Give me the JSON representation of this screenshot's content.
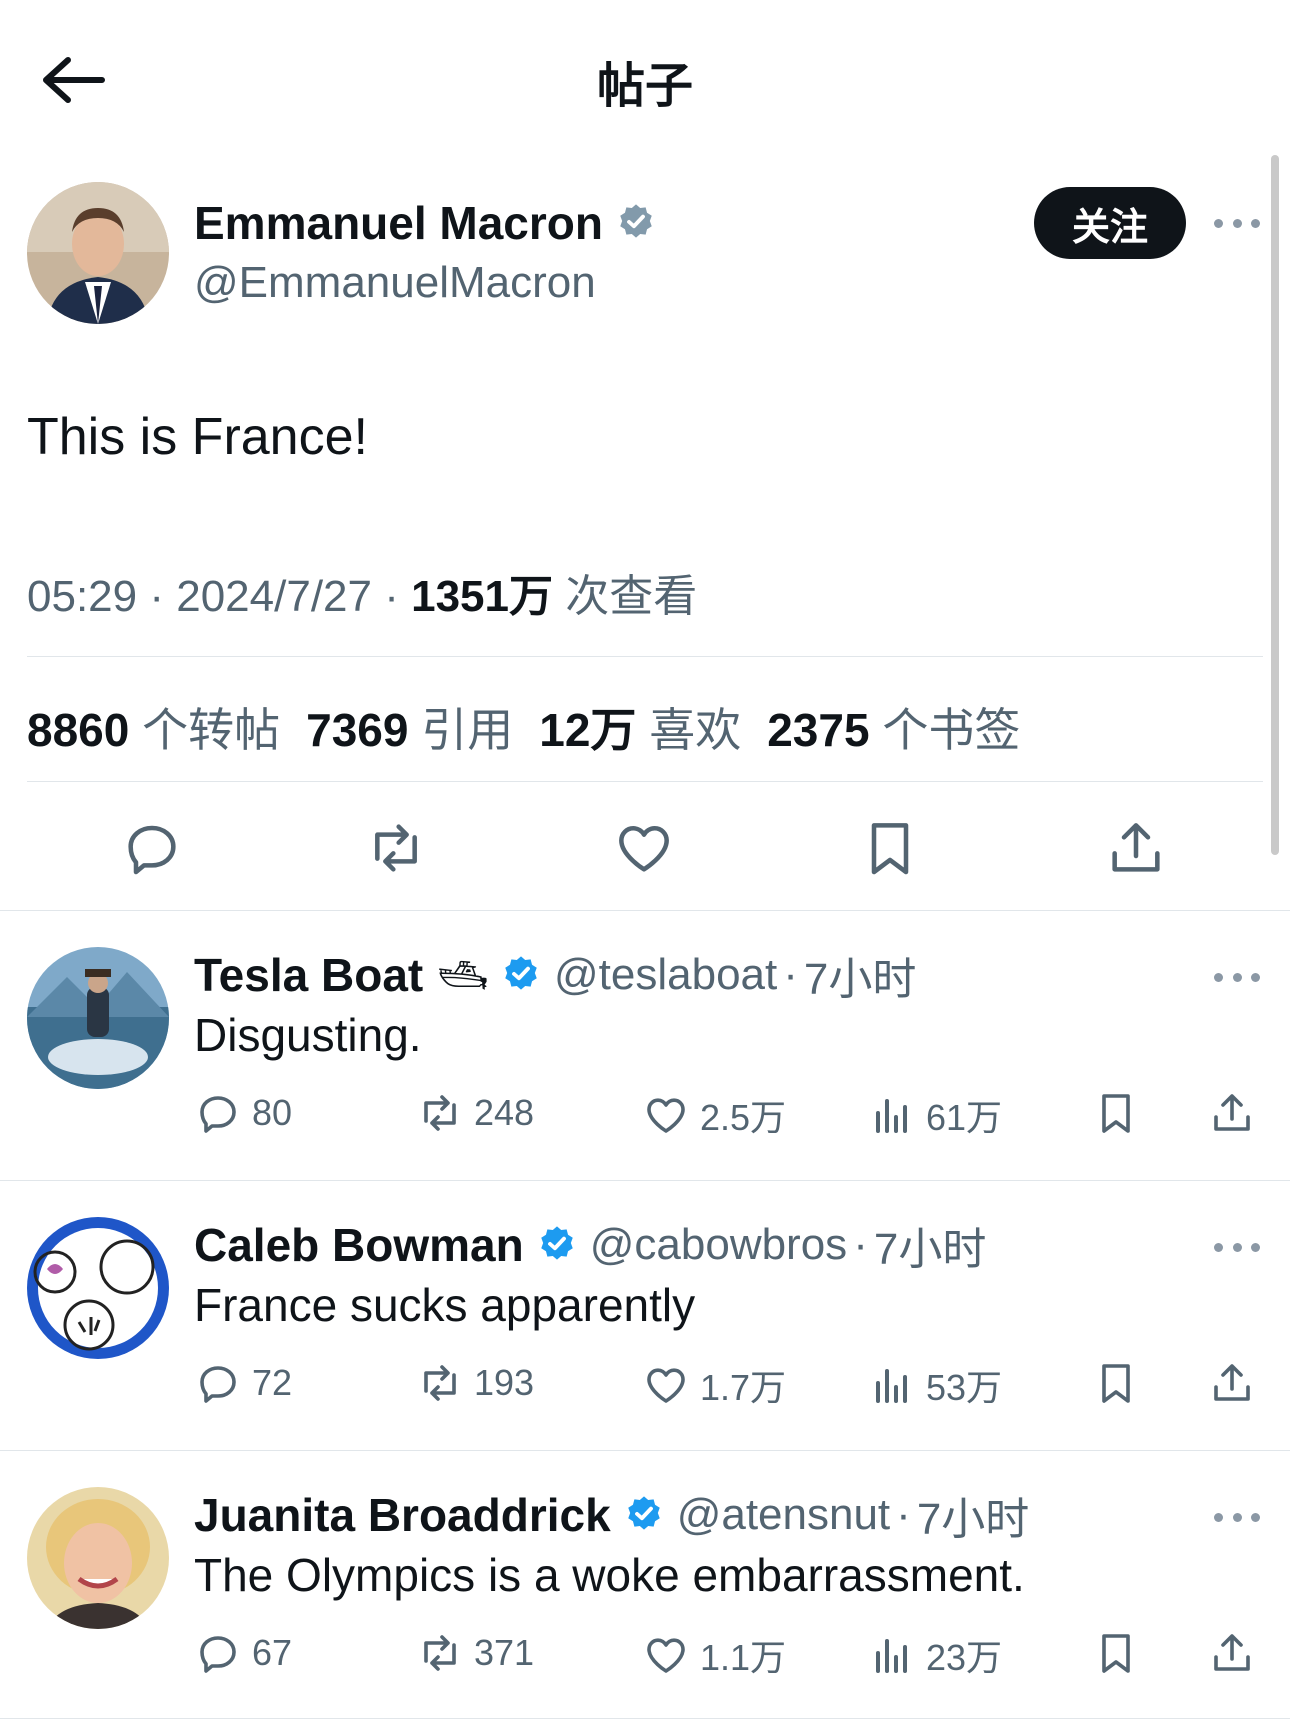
{
  "header": {
    "title": "帖子"
  },
  "post": {
    "author": {
      "name": "Emmanuel Macron",
      "handle": "@EmmanuelMacron",
      "verified": true,
      "verified_color": "#829aab"
    },
    "follow_label": "关注",
    "text": "This is France!",
    "time": "05:29",
    "date": "2024/7/27",
    "views_count": "1351万",
    "views_label": "次查看",
    "separator": "·",
    "stats": {
      "reposts": {
        "count": "8860",
        "label": "个转帖"
      },
      "quotes": {
        "count": "7369",
        "label": "引用"
      },
      "likes": {
        "count": "12万",
        "label": "喜欢"
      },
      "bookmarks": {
        "count": "2375",
        "label": "个书签"
      }
    }
  },
  "replies": [
    {
      "name": "Tesla Boat",
      "name_emoji": "🛥",
      "handle": "@teslaboat",
      "time": "7小时",
      "text": "Disgusting.",
      "replies": "80",
      "reposts": "248",
      "likes": "2.5万",
      "views": "61万"
    },
    {
      "name": "Caleb Bowman",
      "handle": "@cabowbros",
      "time": "7小时",
      "text": "France sucks apparently",
      "replies": "72",
      "reposts": "193",
      "likes": "1.7万",
      "views": "53万"
    },
    {
      "name": "Juanita Broaddrick",
      "handle": "@atensnut",
      "time": "7小时",
      "text": "The Olympics is a woke embarrassment.",
      "replies": "67",
      "reposts": "371",
      "likes": "1.1万",
      "views": "23万"
    }
  ],
  "colors": {
    "verified_blue": "#1d9bf0",
    "text": "#0f1419",
    "secondary": "#536471",
    "follow_bg": "#0f1419"
  }
}
